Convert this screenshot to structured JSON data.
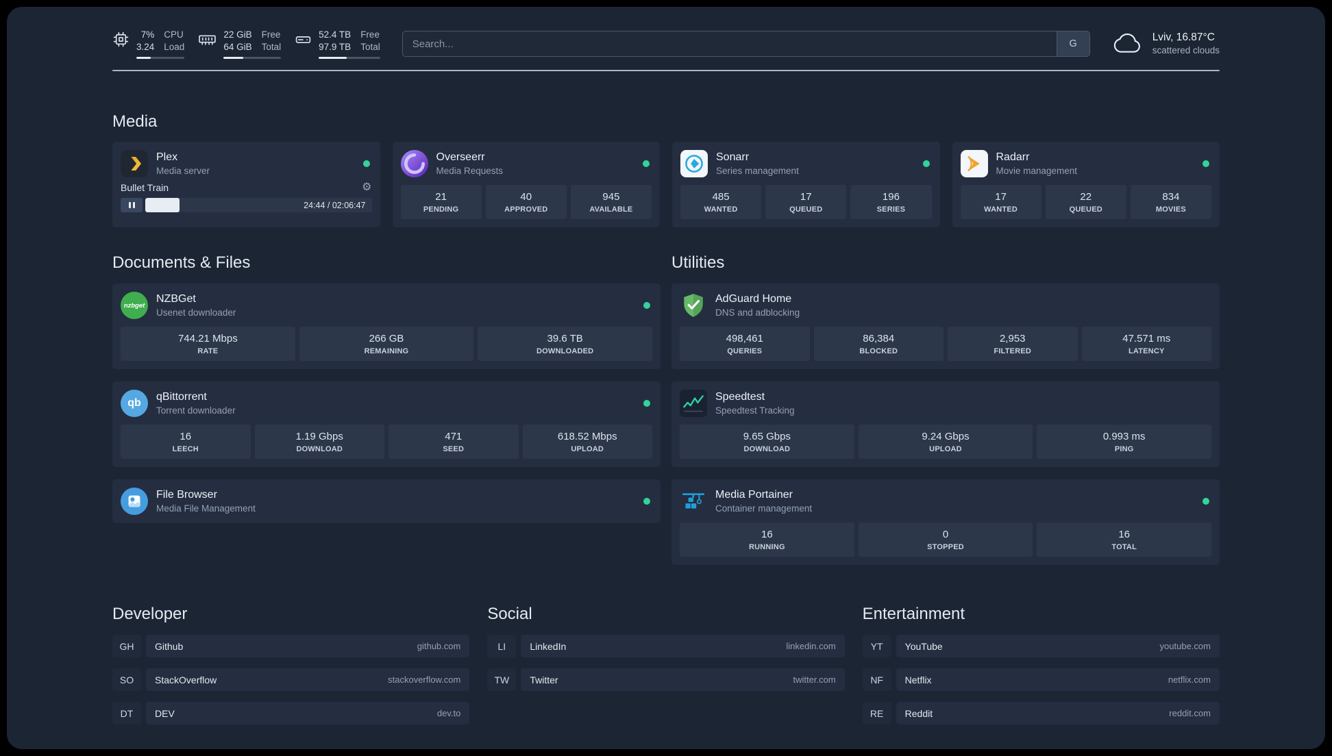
{
  "topbar": {
    "resources": [
      {
        "name": "cpu",
        "values": [
          "7%",
          "3.24"
        ],
        "labels": [
          "CPU",
          "Load"
        ]
      },
      {
        "name": "memory",
        "values": [
          "22 GiB",
          "64 GiB"
        ],
        "labels": [
          "Free",
          "Total"
        ]
      },
      {
        "name": "disk",
        "values": [
          "52.4 TB",
          "97.9 TB"
        ],
        "labels": [
          "Free",
          "Total"
        ]
      }
    ],
    "search": {
      "placeholder": "Search...",
      "provider": "G"
    },
    "weather": {
      "location": "Lviv, 16.87°C",
      "condition": "scattered clouds"
    }
  },
  "groups": {
    "media": {
      "title": "Media",
      "plex": {
        "name": "Plex",
        "desc": "Media server",
        "now_playing": "Bullet Train",
        "time": "24:44 / 02:06:47"
      },
      "overseerr": {
        "name": "Overseerr",
        "desc": "Media Requests",
        "stats": [
          {
            "value": "21",
            "label": "PENDING"
          },
          {
            "value": "40",
            "label": "APPROVED"
          },
          {
            "value": "945",
            "label": "AVAILABLE"
          }
        ]
      },
      "sonarr": {
        "name": "Sonarr",
        "desc": "Series management",
        "stats": [
          {
            "value": "485",
            "label": "WANTED"
          },
          {
            "value": "17",
            "label": "QUEUED"
          },
          {
            "value": "196",
            "label": "SERIES"
          }
        ]
      },
      "radarr": {
        "name": "Radarr",
        "desc": "Movie management",
        "stats": [
          {
            "value": "17",
            "label": "WANTED"
          },
          {
            "value": "22",
            "label": "QUEUED"
          },
          {
            "value": "834",
            "label": "MOVIES"
          }
        ]
      }
    },
    "documents": {
      "title": "Documents & Files",
      "nzbget": {
        "name": "NZBGet",
        "desc": "Usenet downloader",
        "stats": [
          {
            "value": "744.21 Mbps",
            "label": "RATE"
          },
          {
            "value": "266 GB",
            "label": "REMAINING"
          },
          {
            "value": "39.6 TB",
            "label": "DOWNLOADED"
          }
        ]
      },
      "qbittorrent": {
        "name": "qBittorrent",
        "desc": "Torrent downloader",
        "stats": [
          {
            "value": "16",
            "label": "LEECH"
          },
          {
            "value": "1.19 Gbps",
            "label": "DOWNLOAD"
          },
          {
            "value": "471",
            "label": "SEED"
          },
          {
            "value": "618.52 Mbps",
            "label": "UPLOAD"
          }
        ]
      },
      "filebrowser": {
        "name": "File Browser",
        "desc": "Media File Management"
      }
    },
    "utilities": {
      "title": "Utilities",
      "adguard": {
        "name": "AdGuard Home",
        "desc": "DNS and adblocking",
        "stats": [
          {
            "value": "498,461",
            "label": "QUERIES"
          },
          {
            "value": "86,384",
            "label": "BLOCKED"
          },
          {
            "value": "2,953",
            "label": "FILTERED"
          },
          {
            "value": "47.571 ms",
            "label": "LATENCY"
          }
        ]
      },
      "speedtest": {
        "name": "Speedtest",
        "desc": "Speedtest Tracking",
        "stats": [
          {
            "value": "9.65 Gbps",
            "label": "DOWNLOAD"
          },
          {
            "value": "9.24 Gbps",
            "label": "UPLOAD"
          },
          {
            "value": "0.993 ms",
            "label": "PING"
          }
        ]
      },
      "portainer": {
        "name": "Media Portainer",
        "desc": "Container management",
        "stats": [
          {
            "value": "16",
            "label": "RUNNING"
          },
          {
            "value": "0",
            "label": "STOPPED"
          },
          {
            "value": "16",
            "label": "TOTAL"
          }
        ]
      }
    }
  },
  "bookmarks": [
    {
      "title": "Developer",
      "items": [
        {
          "abbr": "GH",
          "label": "Github",
          "url": "github.com"
        },
        {
          "abbr": "SO",
          "label": "StackOverflow",
          "url": "stackoverflow.com"
        },
        {
          "abbr": "DT",
          "label": "DEV",
          "url": "dev.to"
        }
      ]
    },
    {
      "title": "Social",
      "items": [
        {
          "abbr": "LI",
          "label": "LinkedIn",
          "url": "linkedin.com"
        },
        {
          "abbr": "TW",
          "label": "Twitter",
          "url": "twitter.com"
        }
      ]
    },
    {
      "title": "Entertainment",
      "items": [
        {
          "abbr": "YT",
          "label": "YouTube",
          "url": "youtube.com"
        },
        {
          "abbr": "NF",
          "label": "Netflix",
          "url": "netflix.com"
        },
        {
          "abbr": "RE",
          "label": "Reddit",
          "url": "reddit.com"
        }
      ]
    }
  ],
  "icons": {
    "gear": "⚙",
    "nzbget_badge": "nzbget",
    "qbittorrent_badge": "qb"
  },
  "colors": {
    "status_online": "#34d399",
    "page_bg": "#1c2534",
    "card_bg": "#242e40",
    "stat_bg": "#2c3749"
  }
}
